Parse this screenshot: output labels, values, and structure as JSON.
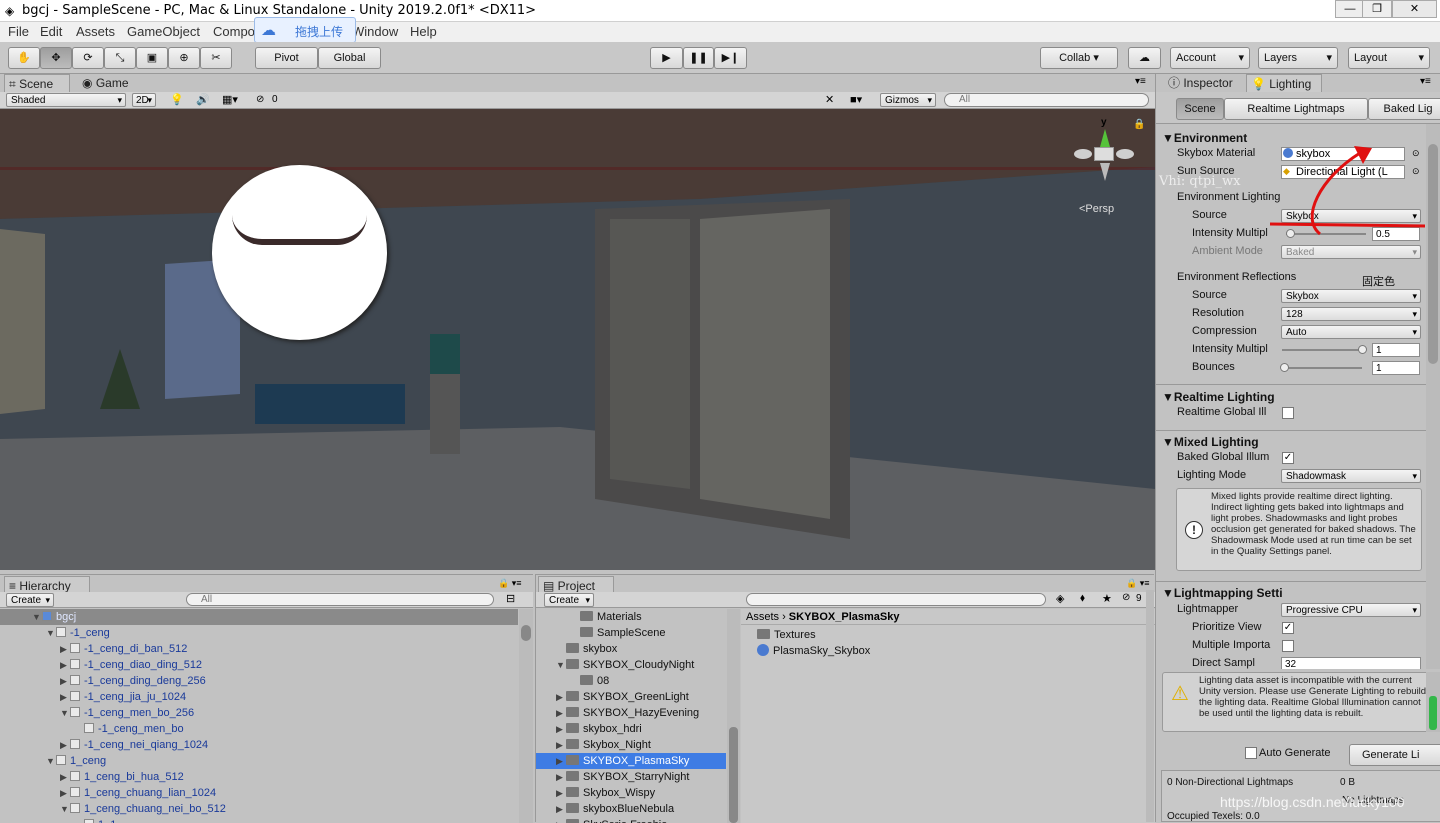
{
  "window": {
    "title": "bgcj - SampleScene - PC, Mac & Linux Standalone - Unity 2019.2.0f1* <DX11>",
    "min": "—",
    "max": "❐",
    "close": "✕"
  },
  "menu": {
    "items": [
      "File",
      "Edit",
      "Assets",
      "GameObject",
      "Compo",
      "Window",
      "Help"
    ],
    "upload_label": "拖拽上传"
  },
  "toolbar": {
    "pivot": "Pivot",
    "global": "Global",
    "collab": "Collab ▾",
    "account": "Account",
    "layers": "Layers",
    "layout": "Layout"
  },
  "scene_view": {
    "tab_scene": "Scene",
    "tab_game": "Game",
    "shade_mode": "Shaded",
    "mode_2d": "2D",
    "fx_count": "0",
    "gizmos": "Gizmos",
    "search_placeholder": "All",
    "axis_y": "y",
    "persp": "<Persp"
  },
  "inspector": {
    "tab_inspector": "Inspector",
    "tab_lighting": "Lighting",
    "sub_tabs": [
      "Scene",
      "Realtime Lightmaps",
      "Baked Lig"
    ],
    "environment": {
      "header": "Environment",
      "skybox_material_label": "Skybox Material",
      "skybox_material": "skybox",
      "sun_source_label": "Sun Source",
      "sun_source": "Directional Light (L",
      "env_lighting_label": "Environment Lighting",
      "source_label": "Source",
      "source": "Skybox",
      "intensity_label": "Intensity Multipl",
      "intensity": "0.5",
      "ambient_label": "Ambient Mode",
      "ambient": "Baked",
      "reflections_label": "Environment Reflections",
      "annotation": "固定色",
      "refl_source_label": "Source",
      "refl_source": "Skybox",
      "resolution_label": "Resolution",
      "resolution": "128",
      "compression_label": "Compression",
      "compression": "Auto",
      "refl_intensity_label": "Intensity Multipl",
      "refl_intensity": "1",
      "bounces_label": "Bounces",
      "bounces": "1"
    },
    "realtime": {
      "header": "Realtime Lighting",
      "gi_label": "Realtime Global Ill"
    },
    "mixed": {
      "header": "Mixed Lighting",
      "baked_gi_label": "Baked Global Illum",
      "mode_label": "Lighting Mode",
      "mode": "Shadowmask",
      "help": "Mixed lights provide realtime direct lighting. Indirect lighting gets baked into lightmaps and light probes. Shadowmasks and light probes occlusion get generated for baked shadows. The Shadowmask Mode used at run time can be set in the Quality Settings panel."
    },
    "lightmapping": {
      "header": "Lightmapping Setti",
      "lightmapper_label": "Lightmapper",
      "lightmapper": "Progressive CPU",
      "prioritize_label": "Prioritize View",
      "multiple_label": "Multiple Importa",
      "direct_label": "Direct Sampl",
      "direct": "32"
    },
    "warning": "Lighting data asset is incompatible with the current Unity version.  Please use Generate Lighting to rebuild the lighting data. Realtime Global Illumination cannot be used until the lighting data is rebuilt.",
    "auto_generate": "Auto Generate",
    "generate": "Generate Li",
    "stats": {
      "lightmaps": "0 Non-Directional Lightmaps",
      "size": "0 B",
      "no_lightmaps": "No Lightmaps",
      "occupied": "Occupied Texels: 0.0"
    },
    "watermark": "https://blog.csdn.net/lucky100",
    "watermark2": "Vhi: qtpi_wx"
  },
  "hierarchy": {
    "tab": "Hierarchy",
    "create": "Create",
    "search_placeholder": "All",
    "rows": [
      {
        "d": 0,
        "t": "▼",
        "n": "bgcj",
        "sel": true
      },
      {
        "d": 1,
        "t": "▼",
        "n": "-1_ceng"
      },
      {
        "d": 2,
        "t": "▶",
        "n": "-1_ceng_di_ban_512"
      },
      {
        "d": 2,
        "t": "▶",
        "n": "-1_ceng_diao_ding_512"
      },
      {
        "d": 2,
        "t": "▶",
        "n": "-1_ceng_ding_deng_256"
      },
      {
        "d": 2,
        "t": "▶",
        "n": "-1_ceng_jia_ju_1024"
      },
      {
        "d": 2,
        "t": "▼",
        "n": "-1_ceng_men_bo_256"
      },
      {
        "d": 3,
        "t": "",
        "n": "-1_ceng_men_bo"
      },
      {
        "d": 2,
        "t": "▶",
        "n": "-1_ceng_nei_qiang_1024"
      },
      {
        "d": 1,
        "t": "▼",
        "n": "1_ceng"
      },
      {
        "d": 2,
        "t": "▶",
        "n": "1_ceng_bi_hua_512"
      },
      {
        "d": 2,
        "t": "▶",
        "n": "1_ceng_chuang_lian_1024"
      },
      {
        "d": 2,
        "t": "▼",
        "n": "1_ceng_chuang_nei_bo_512"
      },
      {
        "d": 3,
        "t": "",
        "n": "1_1_..."
      }
    ]
  },
  "project": {
    "tab": "Project",
    "create": "Create",
    "count": "9",
    "folders": [
      {
        "d": 1,
        "t": "",
        "n": "Materials"
      },
      {
        "d": 1,
        "t": "",
        "n": "SampleScene"
      },
      {
        "d": 0,
        "t": "",
        "n": "skybox"
      },
      {
        "d": 0,
        "t": "▼",
        "n": "SKYBOX_CloudyNight"
      },
      {
        "d": 1,
        "t": "",
        "n": "08"
      },
      {
        "d": 0,
        "t": "▶",
        "n": "SKYBOX_GreenLight"
      },
      {
        "d": 0,
        "t": "▶",
        "n": "SKYBOX_HazyEvening"
      },
      {
        "d": 0,
        "t": "▶",
        "n": "skybox_hdri"
      },
      {
        "d": 0,
        "t": "▶",
        "n": "Skybox_Night"
      },
      {
        "d": 0,
        "t": "▶",
        "n": "SKYBOX_PlasmaSky",
        "sel": true
      },
      {
        "d": 0,
        "t": "▶",
        "n": "SKYBOX_StarryNight"
      },
      {
        "d": 0,
        "t": "▶",
        "n": "Skybox_Wispy"
      },
      {
        "d": 0,
        "t": "▶",
        "n": "skyboxBlueNebula"
      },
      {
        "d": 0,
        "t": "▶",
        "n": "SkySerie Freebie"
      }
    ],
    "breadcrumb_root": "Assets",
    "breadcrumb_current": "SKYBOX_PlasmaSky",
    "assets": [
      {
        "n": "Textures",
        "k": "folder"
      },
      {
        "n": "PlasmaSky_Skybox",
        "k": "material"
      }
    ]
  },
  "colors": {
    "accent": "#3d78d6",
    "selection": "#3e7ce4",
    "annotation_red": "#e01010"
  }
}
